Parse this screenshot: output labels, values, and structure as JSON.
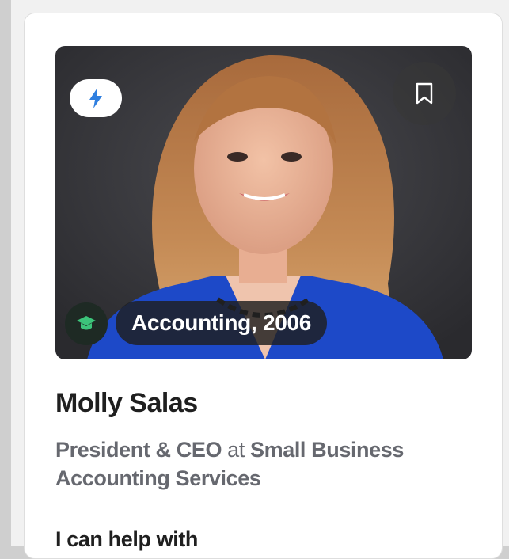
{
  "profile": {
    "name": "Molly Salas",
    "role_title": "President & CEO",
    "role_connector": "at",
    "company": "Small Business Accounting Services",
    "education": "Accounting, 2006",
    "help_heading": "I can help with"
  },
  "icons": {
    "fast_response": "lightning-bolt-icon",
    "bookmark": "bookmark-icon",
    "education": "graduation-cap-icon"
  },
  "colors": {
    "lightning": "#2f7fe0",
    "graduation_cap": "#3cc47a",
    "name_text": "#1f1f1f",
    "role_text": "#66686f",
    "jacket": "#1d49c8",
    "hair": "#b97a46"
  }
}
